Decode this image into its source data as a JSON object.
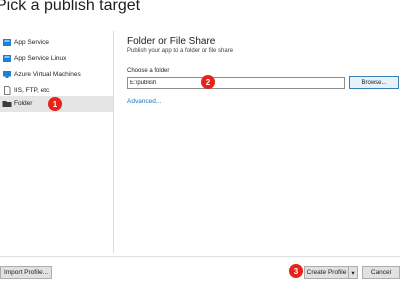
{
  "window": {
    "title": "Pick a publish target"
  },
  "sidebar": {
    "items": [
      {
        "label": "App Service",
        "icon": "app-service-icon",
        "color": "#1f80d8"
      },
      {
        "label": "App Service Linux",
        "icon": "app-service-linux-icon",
        "color": "#1f80d8"
      },
      {
        "label": "Azure Virtual Machines",
        "icon": "virtual-machine-icon",
        "color": "#1f80d8"
      },
      {
        "label": "IIS, FTP, etc",
        "icon": "page-icon",
        "color": "#555555"
      },
      {
        "label": "Folder",
        "icon": "folder-icon",
        "color": "#3c3c3c",
        "selected": true
      }
    ]
  },
  "main": {
    "heading": "Folder or File Share",
    "subtitle": "Publish your app to a folder or file share",
    "folder_label": "Choose a folder",
    "folder_value": "E:\\publish",
    "browse_label": "Browse...",
    "advanced_link": "Advanced..."
  },
  "footer": {
    "import_label": "Import Profile...",
    "create_label": "Create Profile",
    "dropdown_glyph": "▾",
    "cancel_label": "Cancel"
  },
  "markers": [
    "1",
    "2",
    "3"
  ],
  "colors": {
    "accent": "#1a73c9",
    "marker": "#e8231c",
    "selected_bg": "#e5e5e5"
  }
}
